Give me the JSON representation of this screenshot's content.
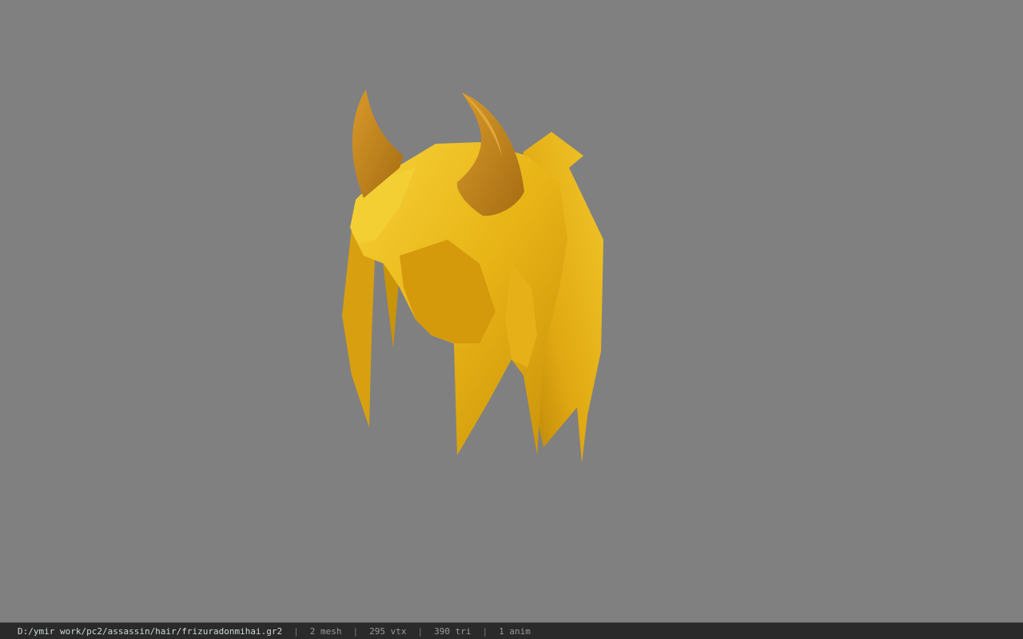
{
  "status": {
    "file_path": "D:/ymir work/pc2/assassin/hair/frizuradonmihai.gr2",
    "separator": "|",
    "mesh_count": "2 mesh",
    "vertex_count": "295 vtx",
    "triangle_count": "390 tri",
    "anim_count": "1 anim"
  },
  "colors": {
    "background": "#808080",
    "hair_base": "#e8b416",
    "hair_light": "#f6d23a",
    "hair_shadow": "#b07c08",
    "horn": "#c88a1e",
    "horn_dark": "#9a6410",
    "status_bg": "#2a2a2a",
    "status_text": "#9a9a9a",
    "path_text": "#cfd8dc"
  }
}
